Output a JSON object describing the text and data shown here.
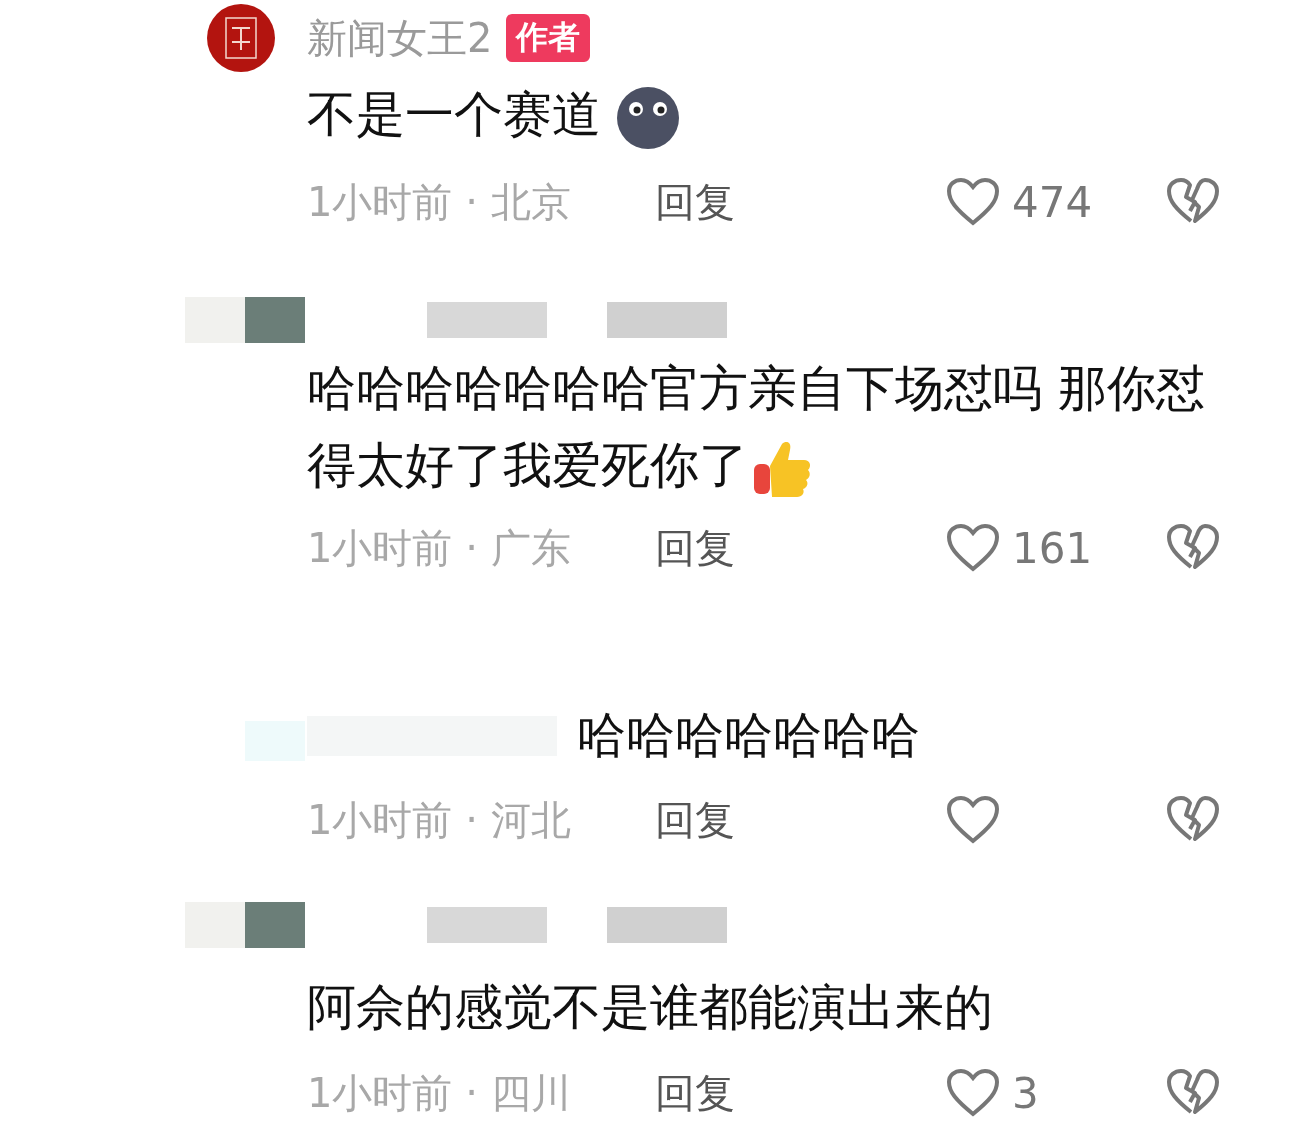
{
  "comments": [
    {
      "kind": "full",
      "avatar": {
        "kind": "logo"
      },
      "author": "新闻女王2",
      "badge": "作者",
      "text": "不是一个赛道",
      "emoji": {
        "kind": "moon-face"
      },
      "meta": "1小时前 · 北京",
      "reply": "回复",
      "likes": "474"
    },
    {
      "kind": "full",
      "avatar": {
        "kind": "blurred"
      },
      "text": "哈哈哈哈哈哈哈官方亲自下场怼吗 那你怼得太好了我爱死你了",
      "emoji": {
        "kind": "thumbs-up"
      },
      "meta": "1小时前 · 广东",
      "reply": "回复",
      "likes": "161"
    },
    {
      "kind": "inline",
      "avatar": {
        "kind": "faint"
      },
      "text": "哈哈哈哈哈哈哈",
      "meta": "1小时前 · 河北",
      "reply": "回复"
    },
    {
      "kind": "full",
      "avatar": {
        "kind": "blurred"
      },
      "text": "阿佘的感觉不是谁都能演出来的",
      "meta": "1小时前 · 四川",
      "reply": "回复",
      "likes": "3"
    }
  ]
}
